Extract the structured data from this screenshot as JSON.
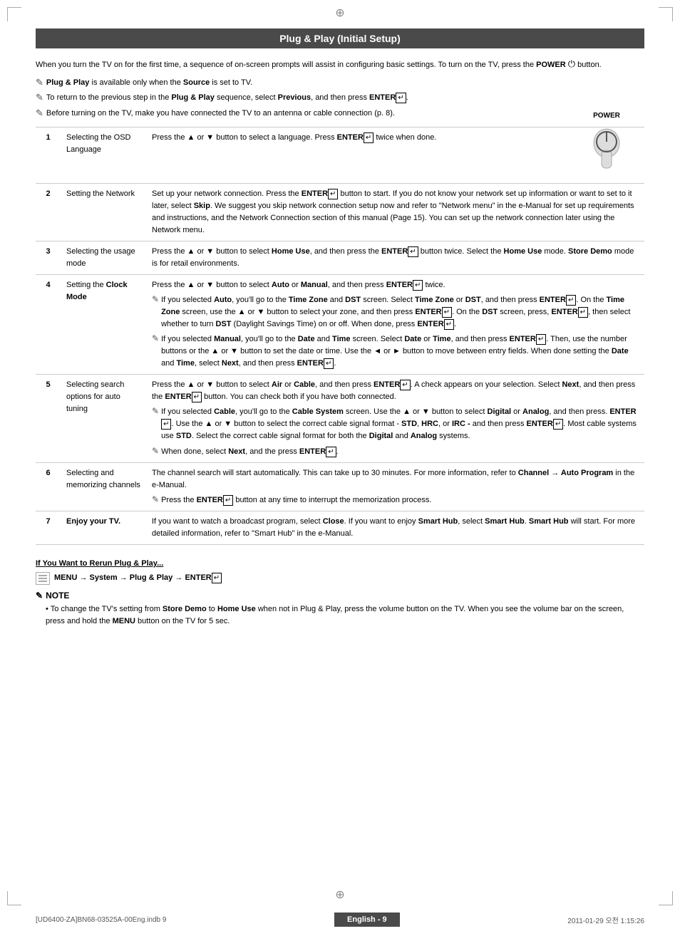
{
  "page": {
    "title": "Plug & Play (Initial Setup)",
    "intro": "When you turn the TV on for the first time, a sequence of on-screen prompts will assist in configuring basic settings. To turn on the TV, press the POWER button.",
    "notes": [
      "Plug & Play is available only when the Source is set to TV.",
      "To return to the previous step in the Plug & Play sequence, select Previous, and then press ENTER.",
      "Before turning on the TV, make you have connected the TV to an antenna or cable connection (p. 8)."
    ],
    "steps": [
      {
        "num": "1",
        "label": "Selecting the OSD Language",
        "content": "Press the ▲ or ▼ button to select a language. Press ENTER twice when done.",
        "subnotes": []
      },
      {
        "num": "2",
        "label": "Setting the Network",
        "content": "Set up your network connection. Press the ENTER button to start. If you do not know your network set up information or want to set to it later, select Skip. We suggest you skip network connection setup now and refer to \"Network menu\" in the e-Manual for set up requirements and instructions, and the Network Connection section of this manual (Page 15). You can set up the network connection later using the Network menu.",
        "subnotes": []
      },
      {
        "num": "3",
        "label": "Selecting the usage mode",
        "content": "Press the ▲ or ▼ button to select Home Use, and then press the ENTER button twice. Select the Home Use mode. Store Demo mode is for retail environments.",
        "subnotes": []
      },
      {
        "num": "4",
        "label": "Setting the Clock Mode",
        "content": "Press the ▲ or ▼ button to select Auto or Manual, and then press ENTER twice.",
        "subnotes": [
          "If you selected Auto, you'll go to the Time Zone and DST screen. Select Time Zone or DST, and then press ENTER. On the Time Zone screen, use the ▲ or ▼ button to select your zone, and then press ENTER. On the DST screen, press, ENTER, then select whether to turn DST (Daylight Savings Time) on or off. When done, press ENTER.",
          "If you selected Manual, you'll go to the Date and Time screen. Select Date or Time, and then press ENTER. Then, use the number buttons or the ▲ or ▼ button to set the date or time. Use the ◄ or ► button to move between entry fields. When done setting the Date and Time, select Next, and then press ENTER."
        ]
      },
      {
        "num": "5",
        "label": "Selecting search options for auto tuning",
        "content": "Press the ▲ or ▼ button to select Air or Cable, and then press ENTER. A check appears on your selection. Select Next, and then press the ENTER button. You can check both if you have both connected.",
        "subnotes": [
          "If you selected Cable, you'll go to the Cable System screen. Use the ▲ or ▼ button to select Digital or Analog, and then press. ENTER. Use the ▲ or ▼ button to select the correct cable signal format - STD, HRC, or IRC - and then press ENTER. Most cable systems use STD. Select the correct cable signal format for both the Digital and Analog systems.",
          "When done, select Next, and the press ENTER."
        ]
      },
      {
        "num": "6",
        "label": "Selecting and memorizing channels",
        "content": "The channel search will start automatically. This can take up to 30 minutes. For more information, refer to Channel → Auto Program in the e-Manual.",
        "subnotes": [
          "Press the ENTER button at any time to interrupt the memorization process."
        ]
      },
      {
        "num": "7",
        "label": "Enjoy your TV.",
        "content": "If you want to watch a broadcast program, select Close. If you want to enjoy Smart Hub, select Smart Hub. Smart Hub will start. For more detailed information, refer to \"Smart Hub\" in the e-Manual.",
        "subnotes": []
      }
    ],
    "rerun": {
      "title": "If You Want to Rerun Plug & Play...",
      "menu_path": "MENU → System → Plug & Play → ENTER"
    },
    "note_section": {
      "title": "NOTE",
      "bullet": "To change the TV's setting from Store Demo to Home Use when not in Plug & Play, press the volume button on the TV. When you see the volume bar on the screen, press and hold the MENU button on the TV for 5 sec."
    },
    "footer": {
      "left": "[UD6400-ZA]BN68-03525A-00Eng.indb   9",
      "center": "English - 9",
      "right": "2011-01-29   오전 1:15:26"
    },
    "power_label": "POWER"
  }
}
